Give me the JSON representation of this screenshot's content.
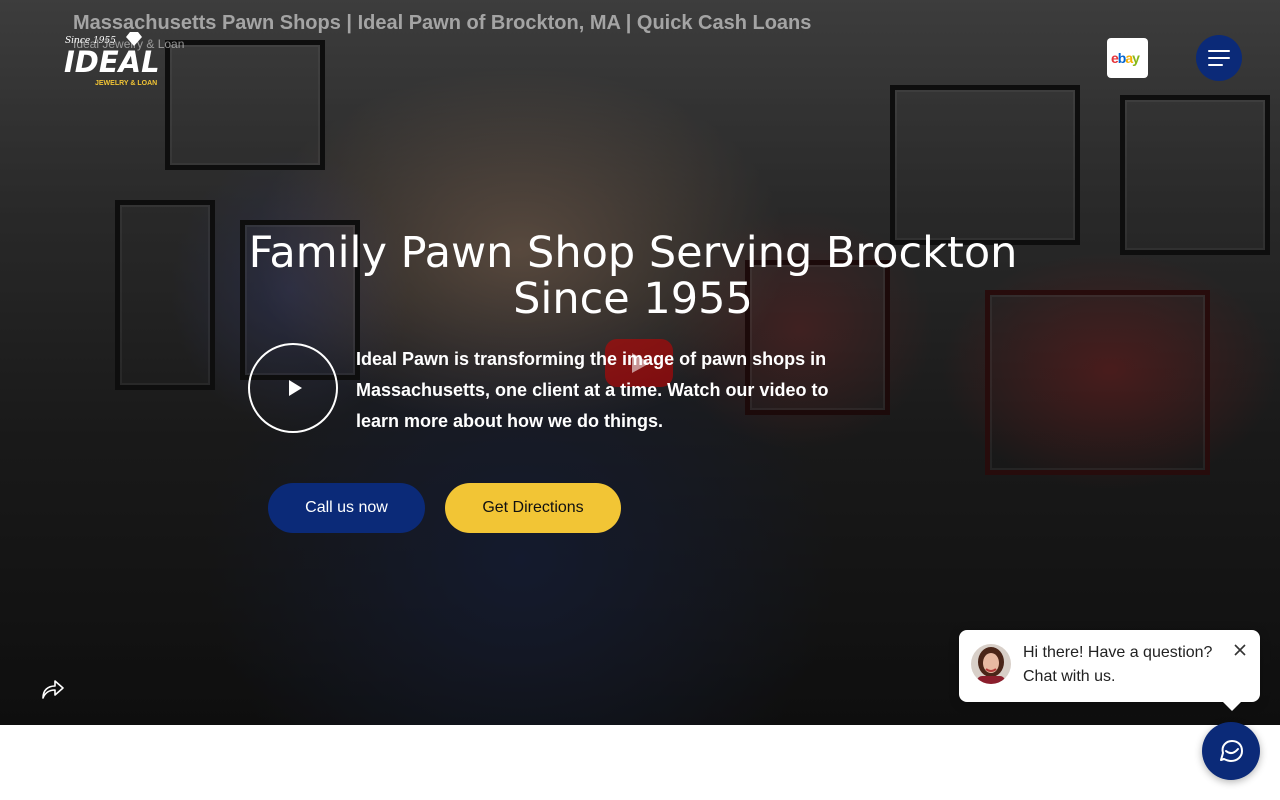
{
  "header": {
    "site_title": "Massachusetts Pawn Shops | Ideal Pawn of Brockton, MA | Quick Cash Loans",
    "tagline": "Ideal Jewelry & Loan",
    "logo_text": {
      "since": "Since 1955",
      "brand": "IDEAL",
      "sub": "JEWELRY & LOAN"
    },
    "ebay_label": "ebay",
    "menu_icon": "hamburger-icon"
  },
  "hero": {
    "headline": "Family Pawn Shop Serving Brockton Since 1955",
    "description": "Ideal Pawn is transforming the image of pawn shops in Massachusetts, one client at a time. Watch our video to learn more about how we do things.",
    "play_icon": "play-icon",
    "video_badge_icon": "youtube-play-icon",
    "share_icon": "share-icon",
    "buttons": {
      "call": "Call us now",
      "directions": "Get Directions"
    }
  },
  "chat": {
    "greeting": "Hi there! Have a question? Chat with us.",
    "close_icon": "close-icon",
    "launcher_icon": "chat-icon",
    "avatar_icon": "agent-avatar"
  },
  "colors": {
    "brand_navy": "#0b2a78",
    "brand_yellow": "#f2c535",
    "text_white": "#ffffff",
    "ebay_red": "#e53238",
    "ebay_blue": "#0064d2",
    "ebay_yellow": "#f5af02",
    "ebay_green": "#86b817"
  }
}
